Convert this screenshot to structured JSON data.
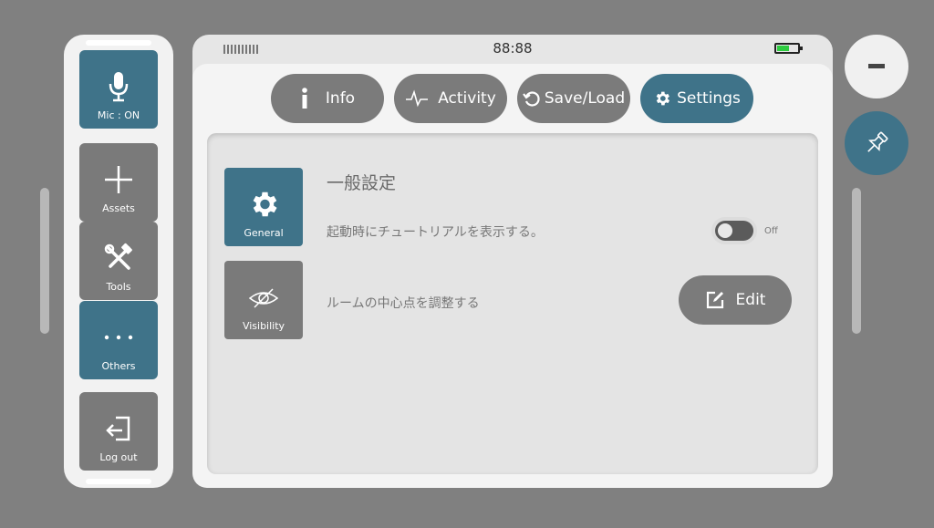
{
  "sidebar": {
    "items": [
      {
        "label": "Mic : ON",
        "icon": "microphone-icon",
        "active": true
      },
      {
        "label": "Assets",
        "icon": "plus-icon",
        "active": false
      },
      {
        "label": "Tools",
        "icon": "tools-icon",
        "active": false
      },
      {
        "label": "Others",
        "icon": "ellipsis-icon",
        "active": true
      },
      {
        "label": "Log out",
        "icon": "logout-icon",
        "active": false
      }
    ]
  },
  "status": {
    "time": "88:88",
    "battery_icon": "battery-icon",
    "signal_icon": "signal-icon"
  },
  "tabs": [
    {
      "label": "Info",
      "icon": "info-icon",
      "active": false
    },
    {
      "label": "Activity",
      "icon": "activity-icon",
      "active": false
    },
    {
      "label": "Save/Load",
      "icon": "refresh-icon",
      "active": false
    },
    {
      "label": "Settings",
      "icon": "gear-icon",
      "active": true
    }
  ],
  "settings": {
    "categories": [
      {
        "label": "General",
        "icon": "gear-icon",
        "active": true
      },
      {
        "label": "Visibility",
        "icon": "eye-slash-icon",
        "active": false
      }
    ],
    "section_title": "一般設定",
    "tutorial_label": "起動時にチュートリアルを表示する。",
    "tutorial_toggle_state": "Off",
    "room_center_label": "ルームの中心点を調整する",
    "edit_label": "Edit"
  },
  "controls": {
    "minimize_icon": "minus-icon",
    "pin_icon": "pin-icon"
  },
  "colors": {
    "background": "#808080",
    "accent": "#3f7389",
    "button_gray": "#7a7a7a",
    "panel": "#f2f2f2",
    "battery": "#2ecc40"
  }
}
